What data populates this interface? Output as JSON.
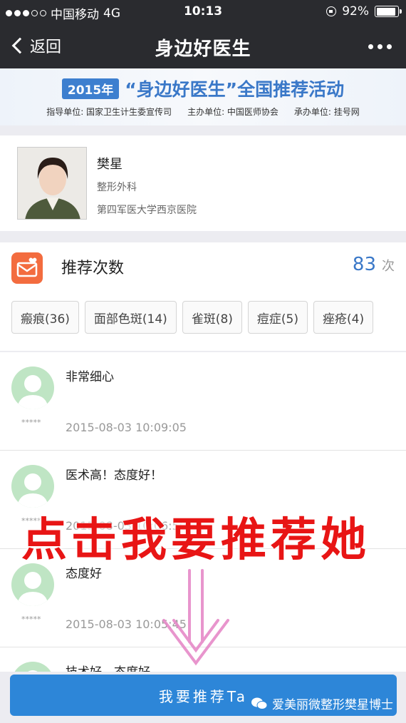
{
  "status_bar": {
    "carrier": "中国移动",
    "network": "4G",
    "time": "10:13",
    "battery": "92%",
    "battery_level": 0.92
  },
  "nav": {
    "back_label": "返回",
    "title": "身边好医生"
  },
  "banner": {
    "year": "2015年",
    "title": "“身边好医生”全国推荐活动",
    "guide": "指导单位: 国家卫生计生委宣传司",
    "host": "主办单位: 中国医师协会",
    "organizer": "承办单位: 挂号网"
  },
  "doctor": {
    "name": "樊星",
    "department": "整形外科",
    "hospital": "第四军医大学西京医院"
  },
  "recommend": {
    "label": "推荐次数",
    "count": "83",
    "unit": "次",
    "tags": [
      "瘢痕(36)",
      "面部色斑(14)",
      "雀斑(8)",
      "痘症(5)",
      "痤疮(4)"
    ]
  },
  "comments": [
    {
      "user": "*****",
      "text": "非常细心",
      "time": "2015-08-03 10:09:05"
    },
    {
      "user": "*****",
      "text": "医术高！态度好！",
      "time": "2015-08-03 10:06:50"
    },
    {
      "user": "*****",
      "text": "态度好",
      "time": "2015-08-03 10:05:45"
    },
    {
      "user": "",
      "text": "技术好，态度好",
      "time": ""
    }
  ],
  "overlay": {
    "text": "点击我要推荐她"
  },
  "bottom": {
    "button_label": "我要推荐Ta",
    "brand": "爱美丽微整形樊星博士"
  },
  "colors": {
    "nav_bg": "#2a2b2f",
    "accent_blue": "#3a78c8",
    "button_blue": "#2d86d8",
    "rec_icon_orange": "#f36c3f",
    "overlay_red": "#e81515",
    "arrow_pink": "#e68ac8"
  }
}
